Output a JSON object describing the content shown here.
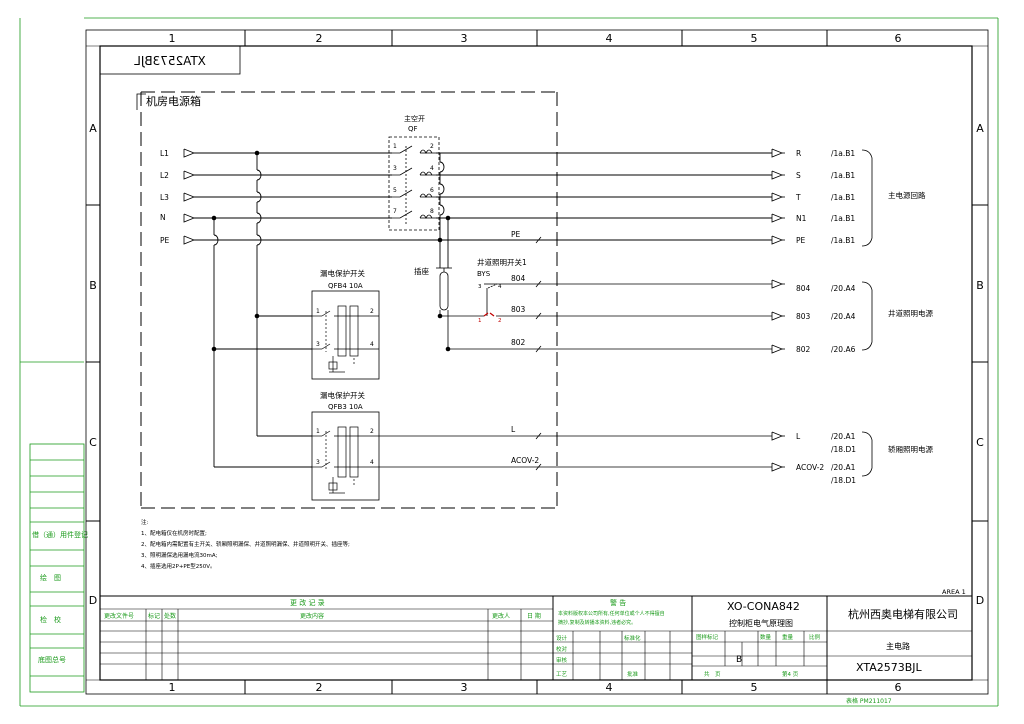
{
  "frame": {
    "cols": [
      "1",
      "2",
      "3",
      "4",
      "5",
      "6"
    ],
    "rows": [
      "A",
      "B",
      "C",
      "D"
    ],
    "mirror_code": "XTA2573BJL",
    "area": "AREA 1"
  },
  "left_strip": {
    "reg": "借（通）用件登记",
    "draw": "绘　图",
    "check": "检　校",
    "dwg": "底图总号"
  },
  "box": {
    "title": "机房电源箱"
  },
  "main_switch": {
    "name": "主空开",
    "code": "QF",
    "terms": [
      "1",
      "2",
      "3",
      "4",
      "5",
      "6",
      "7",
      "8"
    ]
  },
  "inputs": [
    "L1",
    "L2",
    "L3",
    "N",
    "PE"
  ],
  "outputs": [
    {
      "wire": "R",
      "ref": "/1a.B1"
    },
    {
      "wire": "S",
      "ref": "/1a.B1"
    },
    {
      "wire": "T",
      "ref": "/1a.B1"
    },
    {
      "wire": "N1",
      "ref": "/1a.B1"
    },
    {
      "wire": "PE",
      "ref": "/1a.B1"
    }
  ],
  "pe_label": "PE",
  "group_main": "主电源回路",
  "socket": "插座",
  "shaft_switch": {
    "name": "井道照明开关1",
    "code": "BYS",
    "t3": "3",
    "t4": "4",
    "t1": "1",
    "t2": "2"
  },
  "shaft_wires": [
    {
      "wire": "804",
      "ref": "/20.A4"
    },
    {
      "wire": "803",
      "ref": "/20.A4"
    },
    {
      "wire": "802",
      "ref": "/20.A6"
    }
  ],
  "group_shaft": "井道照明电源",
  "rcd1": {
    "name": "漏电保护开关",
    "code": "QFB4 10A",
    "t1": "1",
    "t2": "2",
    "t3": "3",
    "t4": "4"
  },
  "rcd2": {
    "name": "漏电保护开关",
    "code": "QFB3 10A",
    "t1": "1",
    "t2": "2",
    "t3": "3",
    "t4": "4"
  },
  "car_wires": [
    {
      "wire": "L",
      "ref1": "/20.A1",
      "ref2": "/18.D1"
    },
    {
      "wire": "ACOV-2",
      "ref1": "/20.A1",
      "ref2": "/18.D1"
    }
  ],
  "car_wire_labels": [
    "L",
    "ACOV-2"
  ],
  "group_car": "轿厢照明电源",
  "notes": [
    "注:",
    "1、配电箱仅在机房时配置;",
    "2、配电箱内需配置有主开关、轿厢照明漏保、井道照明漏保、井道照明开关、插座等;",
    "3、照明漏保选用漏电流30mA;",
    "4、插座选用2P+PE型250V。"
  ],
  "revision": {
    "title": "更 改 记 录",
    "headers": [
      "更改文件号",
      "标记",
      "处数",
      "更改内容",
      "更改人",
      "日 期"
    ]
  },
  "warning": {
    "title": "警 告",
    "line1": "本资料版权本公司所有,任何单位或个人不得擅自",
    "line2": "摘抄,复制及转播本资料,违者必究。"
  },
  "signoff": [
    {
      "label": "设计",
      "std": "标准化"
    },
    {
      "label": "校对",
      "std": ""
    },
    {
      "label": "审核",
      "std": ""
    },
    {
      "label": "工艺",
      "std": "批准"
    }
  ],
  "title_block": {
    "product": "XO-CONA842",
    "doc": "控制柜电气原理图",
    "company": "杭州西奥电梯有限公司",
    "name": "主电路",
    "code": "XTA2573BJL",
    "stage_label": "图样标记",
    "qty_label": "数量",
    "weight_label": "重量",
    "scale_label": "比例",
    "stage": "B",
    "total_label": "共　页",
    "sheet_label": "第4 页"
  },
  "form_code": "表格 PM211017"
}
